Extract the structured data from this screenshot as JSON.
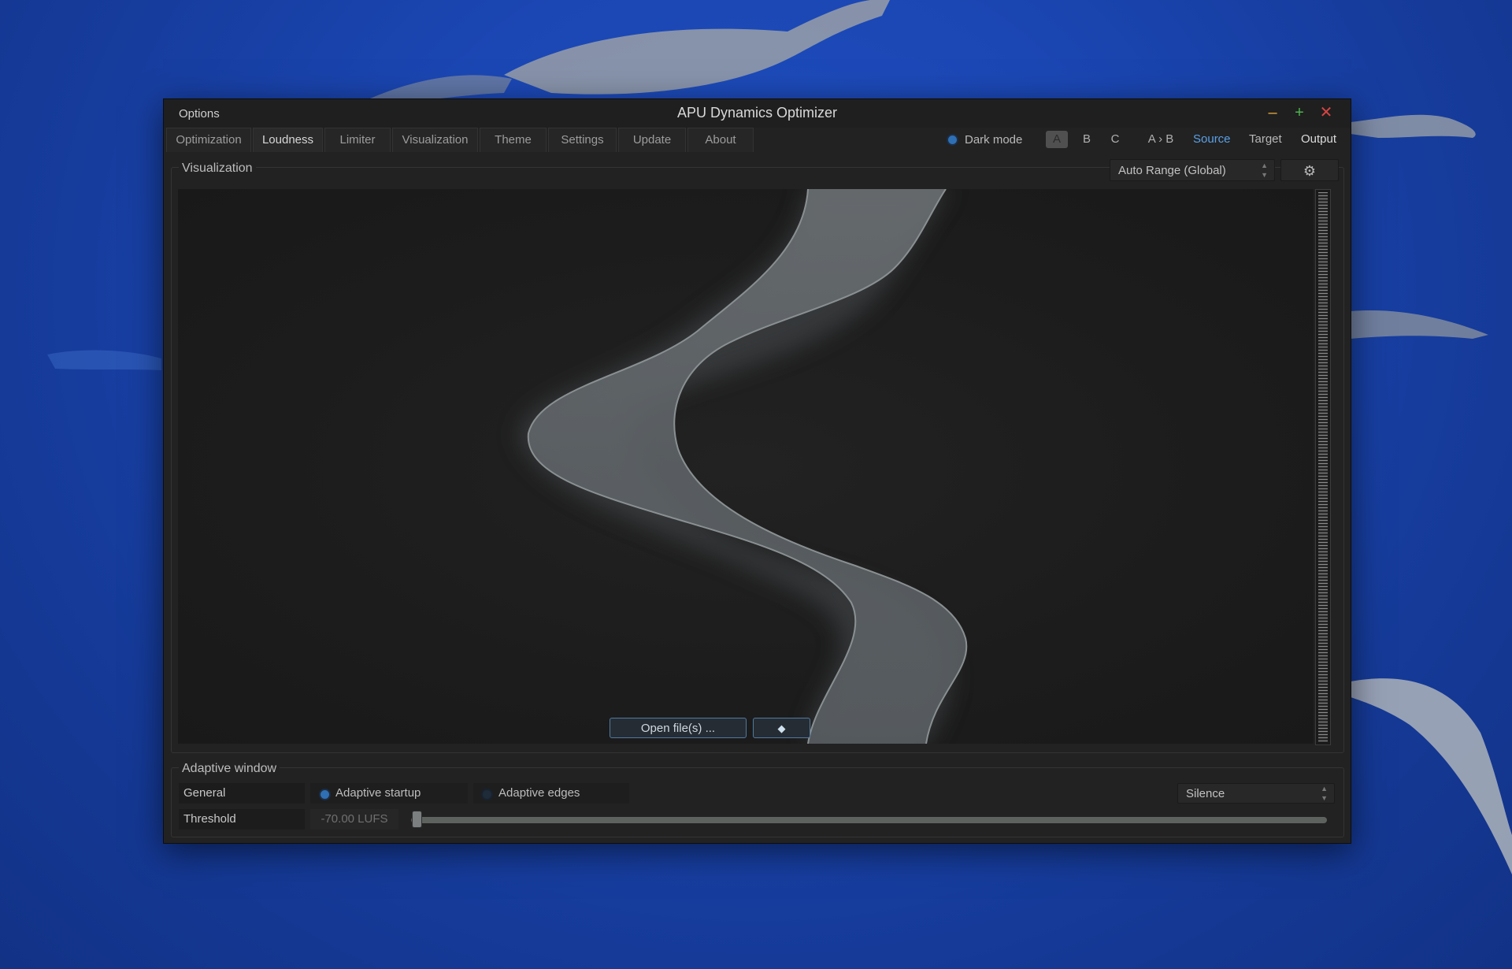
{
  "window": {
    "menu_label": "Options",
    "title": "APU Dynamics Optimizer"
  },
  "tabs": [
    {
      "label": "Optimization"
    },
    {
      "label": "Loudness"
    },
    {
      "label": "Limiter"
    },
    {
      "label": "Visualization"
    },
    {
      "label": "Theme"
    },
    {
      "label": "Settings"
    },
    {
      "label": "Update"
    },
    {
      "label": "About"
    }
  ],
  "active_tab": "Loudness",
  "toolbar": {
    "dark_mode_label": "Dark mode",
    "dark_mode_on": true,
    "compare": [
      "A",
      "B",
      "C",
      "A › B"
    ],
    "compare_selected": "A",
    "views": [
      "Source",
      "Target",
      "Output"
    ],
    "view_active": "Source"
  },
  "visualization": {
    "panel_title": "Visualization",
    "range_select": "Auto Range (Global)",
    "open_button": "Open file(s) ..."
  },
  "adaptive": {
    "panel_title": "Adaptive window",
    "general_label": "General",
    "adaptive_startup_label": "Adaptive startup",
    "adaptive_startup_on": true,
    "adaptive_edges_label": "Adaptive edges",
    "adaptive_edges_on": false,
    "mode_select": "Silence",
    "threshold_label": "Threshold",
    "threshold_value": "-70.00 LUFS",
    "threshold_slider_fraction": 0.0
  },
  "colors": {
    "accent": "#2f6fb4",
    "link_active": "#5aa0e6",
    "minimize": "#e0a43b",
    "maximize": "#4cb24c",
    "close": "#d64545",
    "desktop_blue": "#1b47b4"
  }
}
